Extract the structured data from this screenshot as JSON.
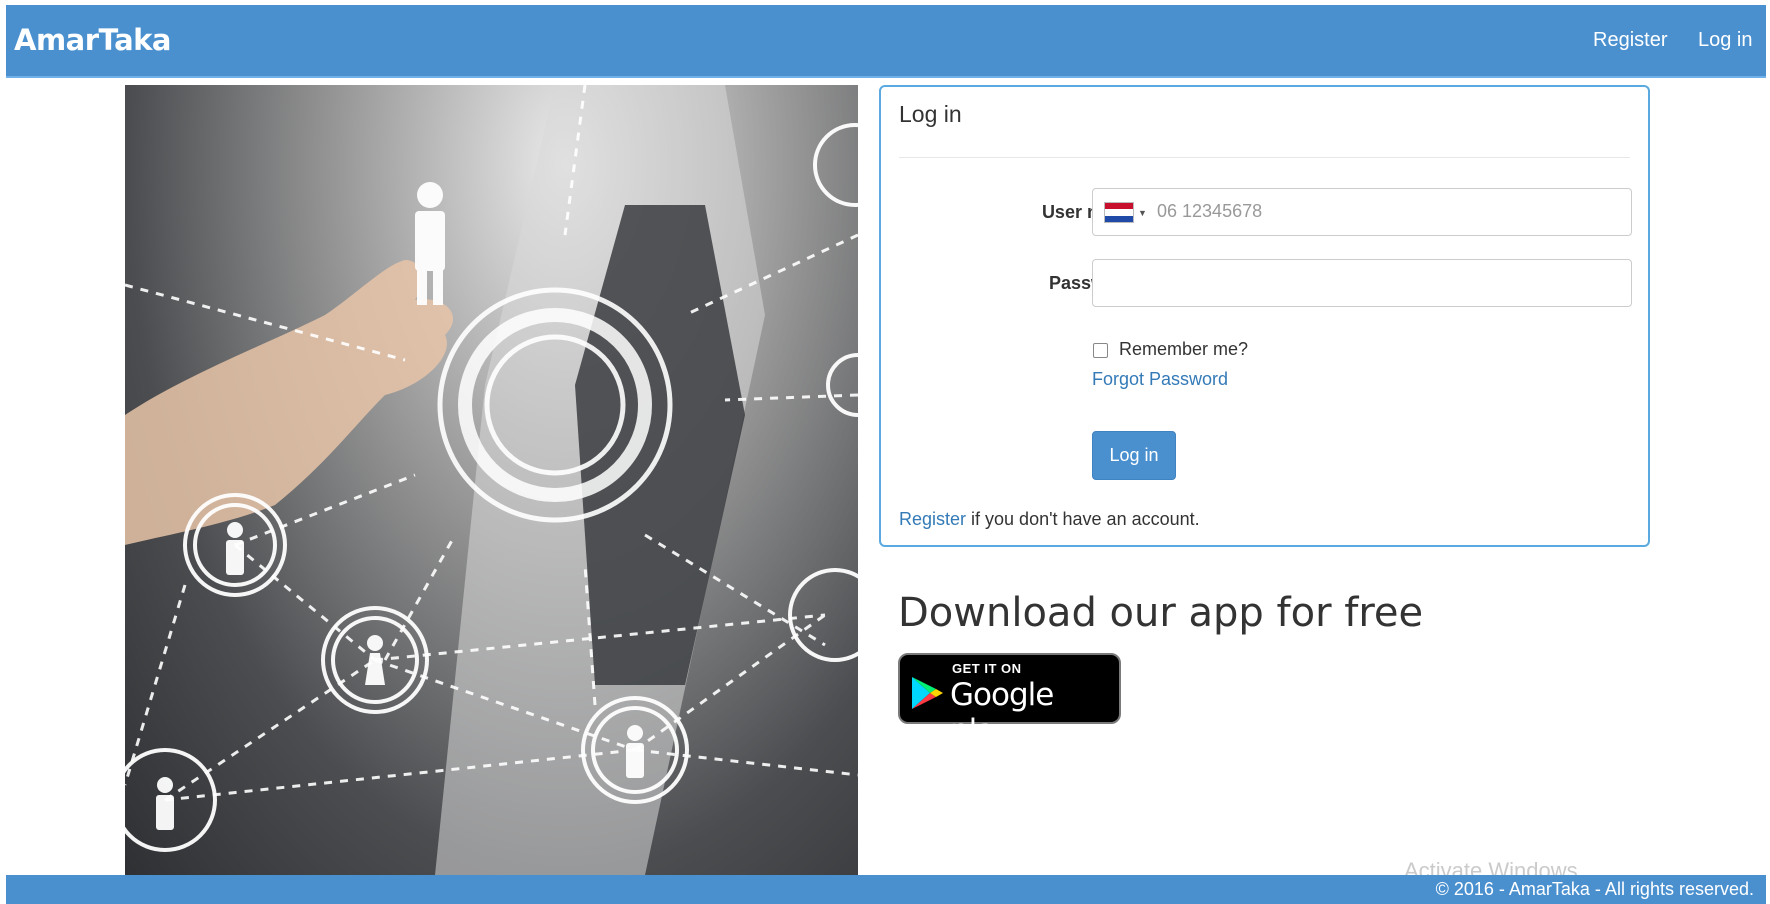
{
  "navbar": {
    "brand": "AmarTaka",
    "links": [
      {
        "label": "Register"
      },
      {
        "label": "Log in"
      }
    ],
    "color": "#4a90cf"
  },
  "hero": {
    "icon": "network-people-image"
  },
  "login": {
    "title": "Log in",
    "username_label": "User name",
    "username_placeholder": "06 12345678",
    "username_country_icon": "netherlands-flag-icon",
    "password_label": "Password",
    "remember_label": "Remember me?",
    "forgot_label": "Forgot Password",
    "submit_label": "Log in",
    "register_link": "Register",
    "register_suffix": " if you don't have an account."
  },
  "download": {
    "heading": "Download our app for free",
    "badge_small": "GET IT ON",
    "badge_big": "Google play"
  },
  "footer": {
    "text": "© 2016 - AmarTaka - All rights reserved."
  },
  "watermark": "Activate Windows"
}
